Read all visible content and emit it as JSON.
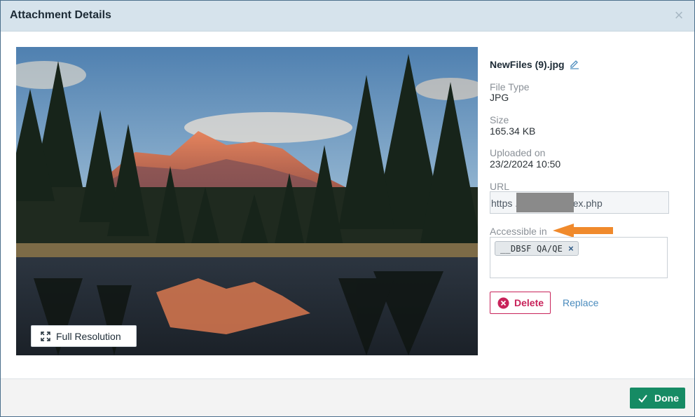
{
  "dialog": {
    "title": "Attachment Details",
    "close_icon": "close-icon"
  },
  "preview": {
    "image_description_icon": "photo-landscape",
    "full_resolution_label": "Full Resolution",
    "full_resolution_icon": "expand-icon"
  },
  "file": {
    "name": "NewFiles (9).jpg",
    "edit_icon": "pencil-icon",
    "fields": [
      {
        "label": "File Type",
        "value": "JPG"
      },
      {
        "label": "Size",
        "value": "165.34 KB"
      },
      {
        "label": "Uploaded on",
        "value": "23/2/2024 10:50"
      }
    ],
    "url_label": "URL",
    "url_value": "https                    .testrail.io/index.php",
    "accessible_label": "Accessible in",
    "accessible_tags": [
      {
        "label": "__DBSF QA/QE"
      }
    ]
  },
  "actions": {
    "delete_label": "Delete",
    "delete_icon": "x-circle-icon",
    "replace_label": "Replace"
  },
  "footer": {
    "done_label": "Done",
    "done_icon": "check-icon"
  },
  "colors": {
    "header_bg": "#d6e3ec",
    "delete_accent": "#c8235a",
    "link": "#4a8bbd",
    "done_bg": "#168b64",
    "annotation_arrow": "#f08a2c"
  }
}
